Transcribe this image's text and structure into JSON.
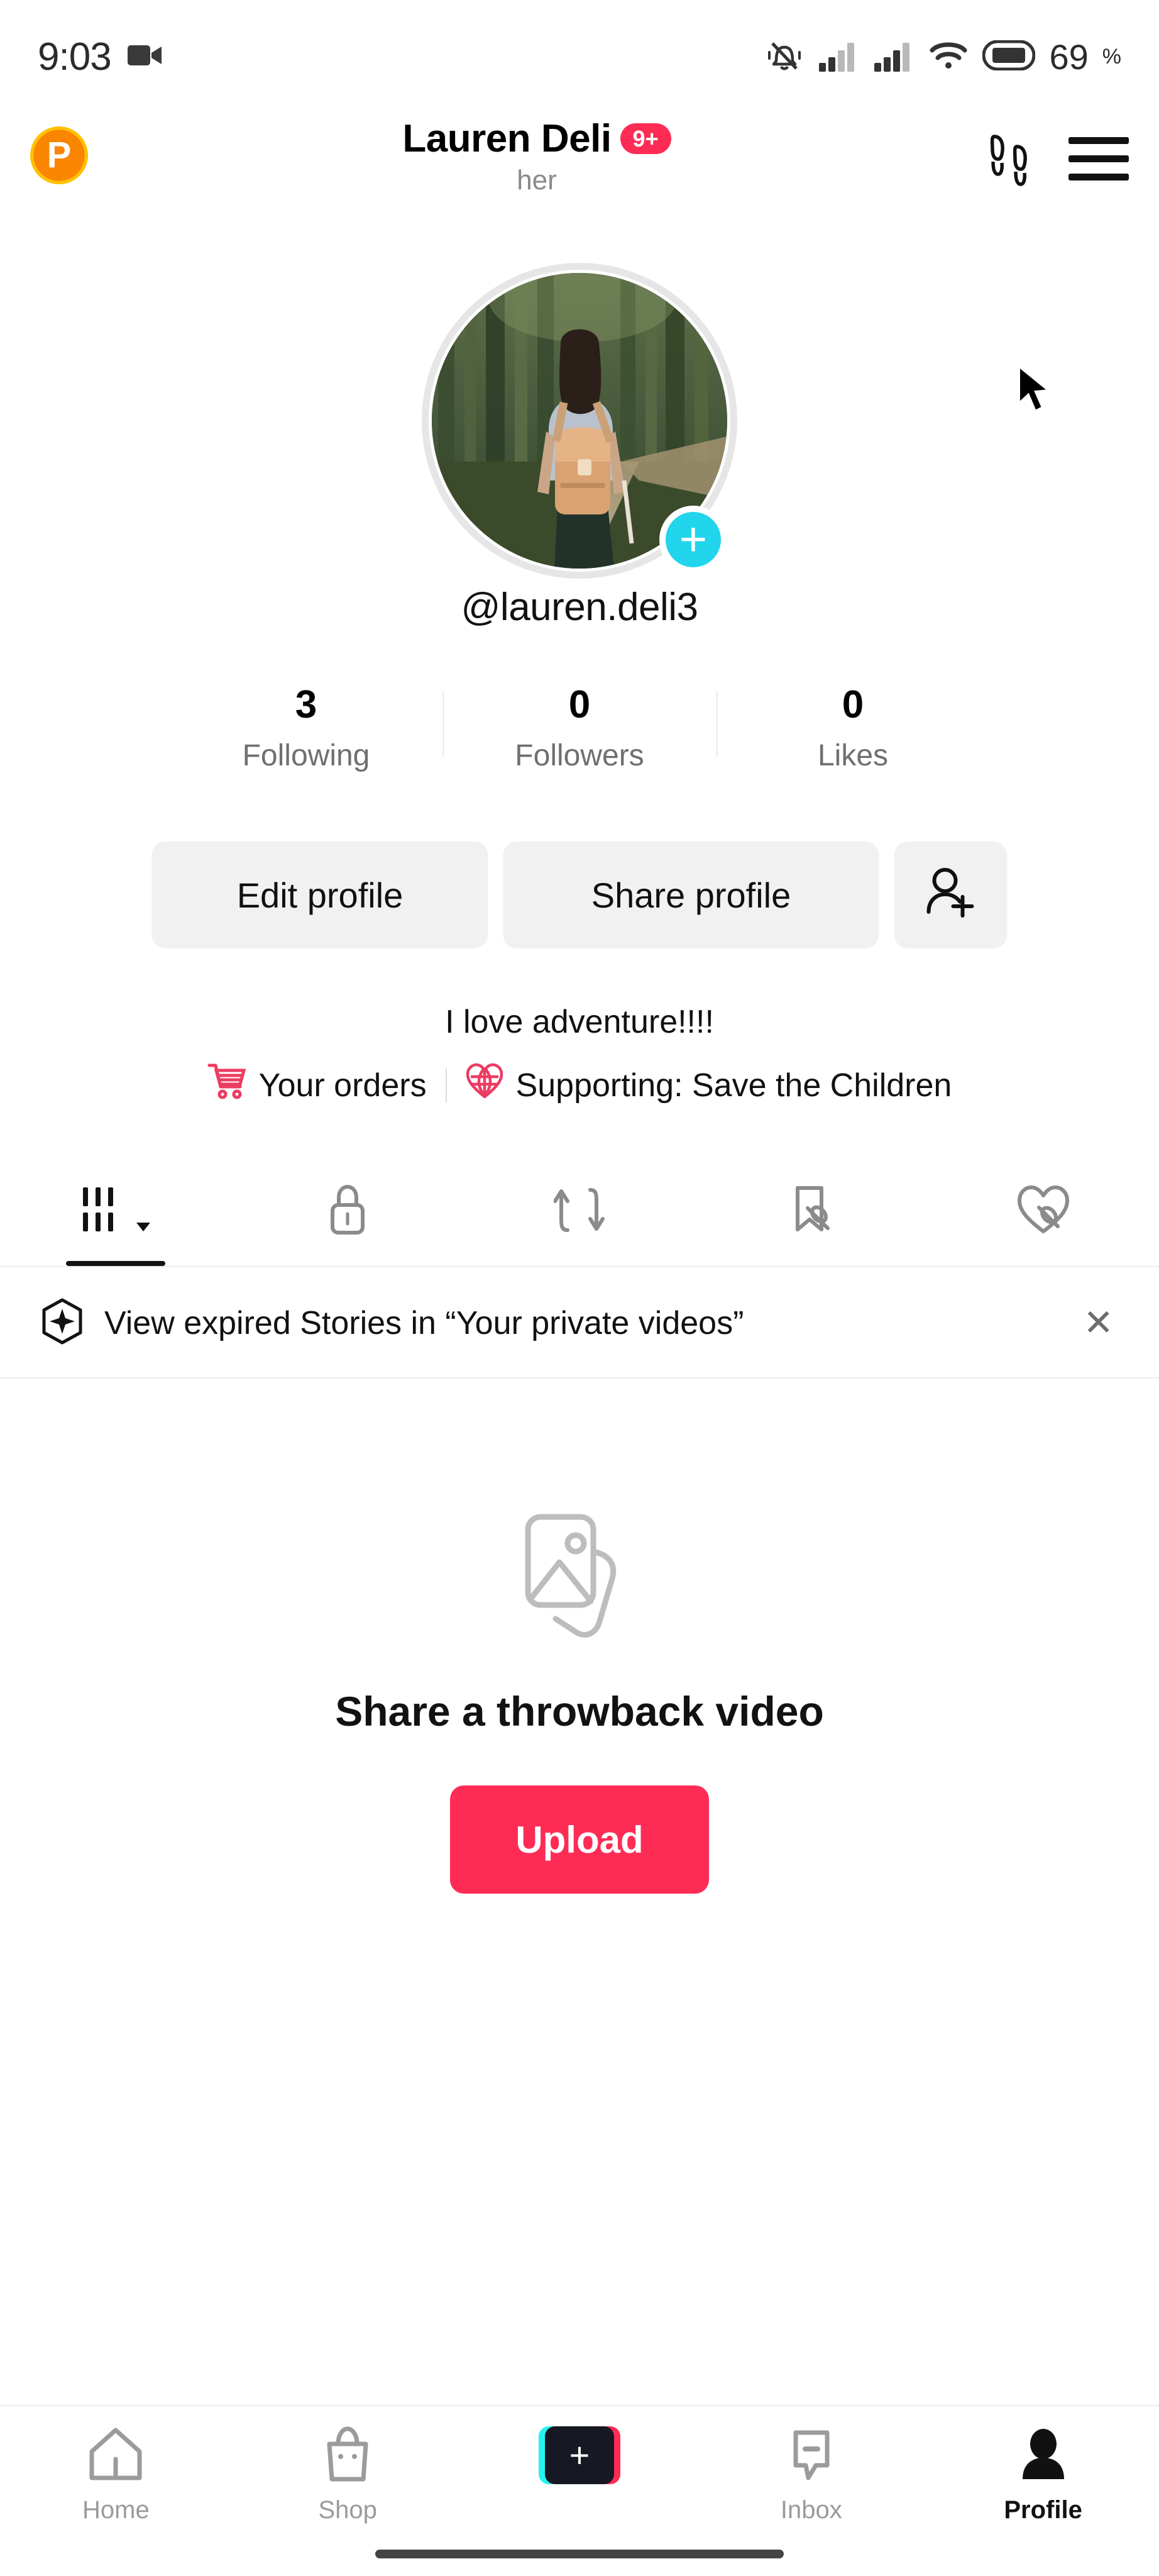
{
  "status_bar": {
    "time": "9:03",
    "screen_record_icon": "video-camera-icon",
    "icons": [
      "mute-bell-icon",
      "signal-bars-icon",
      "signal-bars-icon",
      "wifi-icon",
      "battery-icon"
    ],
    "battery_level": "69",
    "battery_unit": "%"
  },
  "header": {
    "logo_letter": "P",
    "title": "Lauren Deli",
    "badge": "9+",
    "pronouns": "her",
    "footprints_icon": "footprints-icon",
    "menu_icon": "hamburger-menu-icon"
  },
  "profile": {
    "avatar_alt": "woman-with-backpack-hiking-in-forest",
    "add_story_symbol": "+",
    "username": "@lauren.deli3",
    "bio": "I love adventure!!!!"
  },
  "stats": [
    {
      "count": "3",
      "label": "Following"
    },
    {
      "count": "0",
      "label": "Followers"
    },
    {
      "count": "0",
      "label": "Likes"
    }
  ],
  "actions": {
    "edit_profile": "Edit profile",
    "share_profile": "Share profile",
    "add_friends_icon": "person-add-icon"
  },
  "links": {
    "orders_icon": "shopping-cart-icon",
    "orders_label": "Your orders",
    "supporting_icon": "heart-globe-icon",
    "supporting_label": "Supporting: Save the Children"
  },
  "content_tabs": [
    {
      "name": "posts-grid",
      "icon": "grid-bars-icon",
      "active": true,
      "has_caret": true
    },
    {
      "name": "private",
      "icon": "lock-icon",
      "active": false,
      "has_caret": false
    },
    {
      "name": "reposts",
      "icon": "repost-arrows-icon",
      "active": false,
      "has_caret": false
    },
    {
      "name": "saved",
      "icon": "bookmark-slash-icon",
      "active": false,
      "has_caret": false
    },
    {
      "name": "liked",
      "icon": "heart-slash-icon",
      "active": false,
      "has_caret": false
    }
  ],
  "banner": {
    "icon": "sparkle-circle-icon",
    "text": "View expired Stories in “Your private videos”",
    "close_symbol": "✕"
  },
  "empty_state": {
    "icon": "stacked-photos-icon",
    "title": "Share a throwback video",
    "button_label": "Upload"
  },
  "bottom_nav": [
    {
      "label": "Home",
      "icon": "home-icon",
      "active": false
    },
    {
      "label": "Shop",
      "icon": "shop-bag-icon",
      "active": false
    },
    {
      "label": "",
      "icon": "create-plus-icon",
      "active": false
    },
    {
      "label": "Inbox",
      "icon": "inbox-message-icon",
      "active": false
    },
    {
      "label": "Profile",
      "icon": "person-icon",
      "active": true
    }
  ],
  "colors": {
    "accent_red": "#FE2C55",
    "accent_cyan": "#25F4EE",
    "story_add_cyan": "#20D5EC",
    "button_gray": "#f1f1f2",
    "logo_orange": "#F98500"
  }
}
